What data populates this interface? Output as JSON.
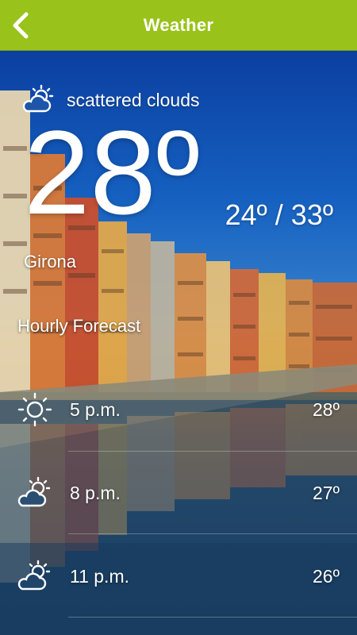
{
  "app": {
    "title": "Weather",
    "accent_color": "#99c21a"
  },
  "current": {
    "condition": "scattered clouds",
    "condition_icon": "partly-cloudy-icon",
    "temperature": "28º",
    "range": "24º / 33º",
    "city": "Girona"
  },
  "hourly": {
    "title": "Hourly Forecast",
    "items": [
      {
        "time": "5 p.m.",
        "temp": "28º",
        "icon": "sun-icon"
      },
      {
        "time": "8 p.m.",
        "temp": "27º",
        "icon": "partly-cloudy-icon"
      },
      {
        "time": "11 p.m.",
        "temp": "26º",
        "icon": "partly-cloudy-icon"
      }
    ]
  }
}
